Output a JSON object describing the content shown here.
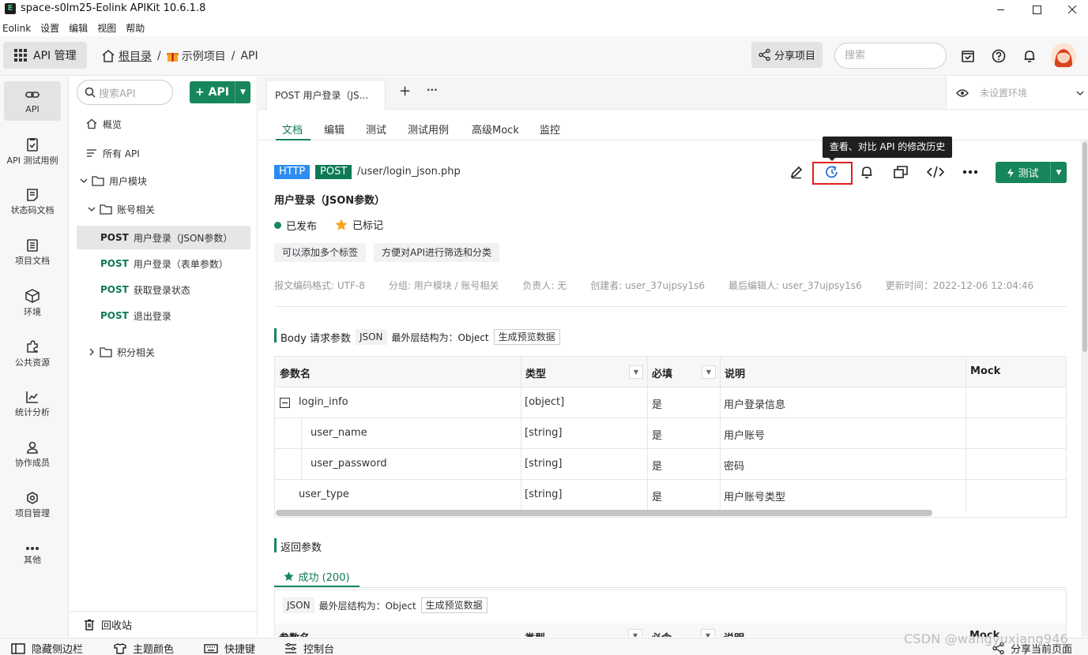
{
  "window": {
    "title": "space-s0lm25-Eolink APIKit 10.6.1.8",
    "app_icon": "E"
  },
  "menu": [
    "Eolink",
    "设置",
    "编辑",
    "视图",
    "帮助"
  ],
  "toolbar": {
    "api_mgmt_label": "API 管理",
    "breadcrumb_root": "根目录",
    "breadcrumb_sep1": "/",
    "breadcrumb_project": "示例项目",
    "breadcrumb_sep2": "/",
    "breadcrumb_api": "API",
    "share_label": "分享项目",
    "search_placeholder": "搜索"
  },
  "rail": [
    {
      "label": "API",
      "icon": "link-icon"
    },
    {
      "label": "API 测试用例",
      "icon": "clipboard-check-icon"
    },
    {
      "label": "状态码文档",
      "icon": "doc-list-icon"
    },
    {
      "label": "项目文档",
      "icon": "document-icon"
    },
    {
      "label": "环境",
      "icon": "cube-icon"
    },
    {
      "label": "公共资源",
      "icon": "puzzle-icon"
    },
    {
      "label": "统计分析",
      "icon": "chart-icon"
    },
    {
      "label": "协作成员",
      "icon": "user-icon"
    },
    {
      "label": "项目管理",
      "icon": "gear-icon"
    },
    {
      "label": "其他",
      "icon": "more-icon"
    }
  ],
  "tree": {
    "search_placeholder": "搜索API",
    "add_api_label": "+ API",
    "overview": "概览",
    "all_api": "所有 API",
    "group_user": "用户模块",
    "group_account": "账号相关",
    "items": [
      {
        "method": "POST",
        "name": "用户登录（JSON参数）"
      },
      {
        "method": "POST",
        "name": "用户登录（表单参数）"
      },
      {
        "method": "POST",
        "name": "获取登录状态"
      },
      {
        "method": "POST",
        "name": "退出登录"
      }
    ],
    "group_points": "积分相关",
    "recycle": "回收站"
  },
  "tabs": {
    "api_tab": "POST 用户登录（JS...",
    "plus": "+",
    "more": "···",
    "env_placeholder": "未设置环境"
  },
  "subtabs": [
    "文档",
    "编辑",
    "测试",
    "测试用例",
    "高级Mock",
    "监控"
  ],
  "api": {
    "protocol": "HTTP",
    "method": "POST",
    "url": "/user/login_json.php",
    "title": "用户登录（JSON参数）",
    "status": "已发布",
    "marked": "已标记",
    "tags": [
      "可以添加多个标签",
      "方便对API进行筛选和分类"
    ],
    "meta": {
      "encoding": "报文编码格式: UTF-8",
      "group": "分组: 用户模块 / 账号相关",
      "owner": "负责人: 无",
      "creator": "创建者: user_37ujpsy1s6",
      "editor": "最后编辑人: user_37ujpsy1s6",
      "updated": "更新时间：2022-12-06 12:04:46"
    },
    "tooltip": "查看、对比 API 的修改历史",
    "test_label": "测试"
  },
  "body_params": {
    "title": "Body 请求参数",
    "format": "JSON",
    "structure": "最外层结构为：Object",
    "preview_btn": "生成预览数据",
    "headers": {
      "name": "参数名",
      "type": "类型",
      "required": "必填",
      "desc": "说明",
      "mock": "Mock"
    },
    "rows": [
      {
        "name": "login_info",
        "type": "[object]",
        "required": "是",
        "desc": "用户登录信息"
      },
      {
        "name": "user_name",
        "type": "[string]",
        "required": "是",
        "desc": "用户账号"
      },
      {
        "name": "user_password",
        "type": "[string]",
        "required": "是",
        "desc": "密码"
      },
      {
        "name": "user_type",
        "type": "[string]",
        "required": "是",
        "desc": "用户账号类型"
      }
    ]
  },
  "response": {
    "title": "返回参数",
    "success_tab": "成功 (200)",
    "format": "JSON",
    "structure": "最外层结构为：Object",
    "preview_btn": "生成预览数据",
    "headers": {
      "name": "参数名",
      "type": "类型",
      "required": "必含",
      "desc": "说明",
      "mock": "Mock"
    }
  },
  "bottom": {
    "hide_sidebar": "隐藏侧边栏",
    "theme": "主题颜色",
    "shortcuts": "快捷键",
    "console": "控制台",
    "share_page": "分享当前页面"
  },
  "watermark": "CSDN @wangyuxiang946",
  "colors": {
    "brand_green": "#17865a",
    "http_blue": "#2d8cf0",
    "highlight_red": "#e02020"
  }
}
